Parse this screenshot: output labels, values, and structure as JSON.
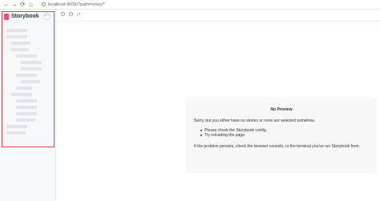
{
  "browser": {
    "back_icon": "←",
    "forward_icon": "→",
    "reload_icon": "⟳",
    "home_icon": "⌂",
    "url": "localhost:9009/?path=/story/*"
  },
  "sidebar": {
    "brand": "Storybook",
    "menu_icon": "⋯",
    "highlight_color": "#e4434a",
    "brand_color": "#ff4785"
  },
  "toolbar": {
    "zoom_reset_icon": "↺"
  },
  "no_preview": {
    "title": "No Preview",
    "message": "Sorry, but you either have no stories or none are selected somehow.",
    "items": [
      "Please check the Storybook config.",
      "Try reloading the page."
    ],
    "footer": "If the problem persists, check the browser console, or the terminal you've run Storybook from."
  }
}
